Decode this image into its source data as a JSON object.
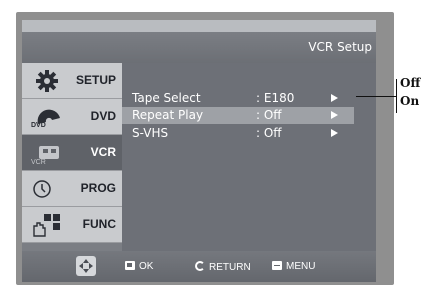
{
  "header": {
    "title": "VCR Setup"
  },
  "sidebar": {
    "items": [
      {
        "label": "SETUP",
        "icon": "gear-icon",
        "active": false
      },
      {
        "label": "DVD",
        "icon": "dvd-disc-icon",
        "icon_text": "DVD",
        "active": false
      },
      {
        "label": "VCR",
        "icon": "vcr-icon",
        "icon_text": "VCR",
        "active": true
      },
      {
        "label": "PROG",
        "icon": "clock-icon",
        "active": false
      },
      {
        "label": "FUNC",
        "icon": "hand-grid-icon",
        "active": false
      }
    ]
  },
  "menu": {
    "rows": [
      {
        "label": "Tape Select",
        "value": ": E180",
        "highlighted": false
      },
      {
        "label": "Repeat Play",
        "value": ": Off",
        "highlighted": true
      },
      {
        "label": "S-VHS",
        "value": ": Off",
        "highlighted": false
      }
    ]
  },
  "footer": {
    "nav_icon": "dpad-icon",
    "ok_label": "OK",
    "return_label": "RETURN",
    "menu_label": "MENU"
  },
  "callout": {
    "options": [
      "Off",
      "On"
    ]
  },
  "colors": {
    "highlight": "#9ea1a6",
    "active_tab": "#5f6268",
    "inactive_tab": "#c9cbce",
    "content_bg": "#6d7077"
  }
}
